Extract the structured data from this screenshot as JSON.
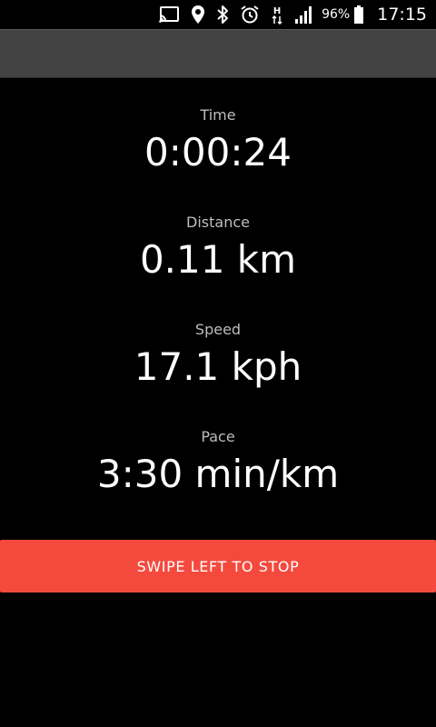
{
  "status_bar": {
    "icons": [
      "cast-icon",
      "location-pin-icon",
      "bluetooth-icon",
      "alarm-icon",
      "hplus-network-icon",
      "signal-icon",
      "battery-icon"
    ],
    "network_label": "H",
    "battery_percent": "96%",
    "time": "17:15"
  },
  "metrics": {
    "time": {
      "label": "Time",
      "value": "0:00:24"
    },
    "distance": {
      "label": "Distance",
      "value": "0.11 km"
    },
    "speed": {
      "label": "Speed",
      "value": "17.1 kph"
    },
    "pace": {
      "label": "Pace",
      "value": "3:30 min/km"
    }
  },
  "swipe_button": {
    "label": "SWIPE LEFT TO STOP"
  },
  "colors": {
    "background": "#000000",
    "app_bar": "#424242",
    "accent": "#f44a3d",
    "label_text": "#bdbdbd",
    "value_text": "#ffffff"
  }
}
